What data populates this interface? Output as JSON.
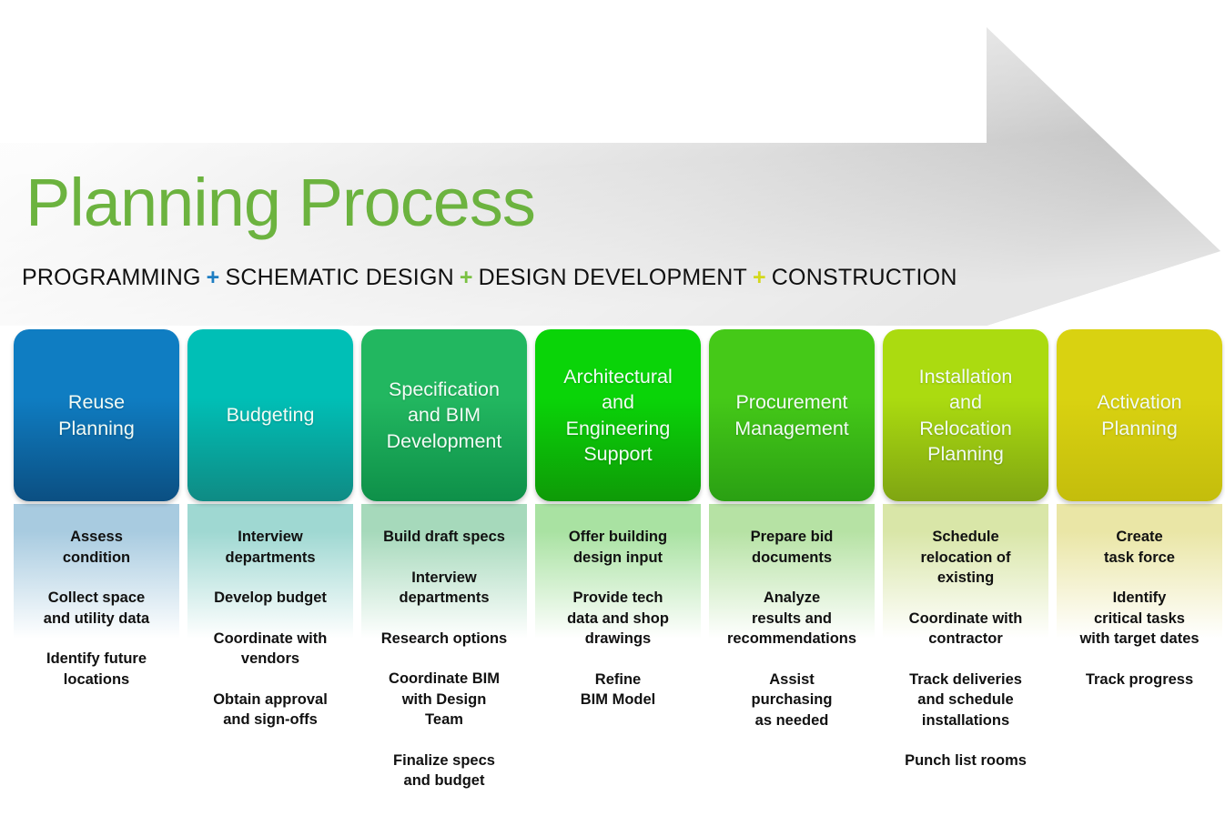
{
  "header": {
    "title": "Planning Process",
    "phases": [
      {
        "label": "PROGRAMMING",
        "separator_after": "+",
        "separator_color": "#1f7ec2"
      },
      {
        "label": "SCHEMATIC DESIGN",
        "separator_after": "+",
        "separator_color": "#7ac143"
      },
      {
        "label": "DESIGN DEVELOPMENT",
        "separator_after": "+",
        "separator_color": "#d3d81c"
      },
      {
        "label": "CONSTRUCTION",
        "separator_after": "",
        "separator_color": ""
      }
    ],
    "title_color": "#6cb33f"
  },
  "arrow": {
    "name": "process-arrow",
    "fill_light": "#fdfdfd",
    "fill_dark": "#bdbdbd"
  },
  "columns": [
    {
      "title": "Reuse\nPlanning",
      "title_lines": [
        "Reuse",
        "Planning"
      ],
      "color_top": "#0f7dc2",
      "color_bottom": "#0b4f82",
      "reflection_top": "#a8cbe0",
      "tasks": [
        "Assess\ncondition",
        "Collect space\nand utility data",
        "Identify future\nlocations"
      ]
    },
    {
      "title": "Budgeting",
      "title_lines": [
        "Budgeting"
      ],
      "color_top": "#00bfb6",
      "color_bottom": "#0f8b84",
      "reflection_top": "#9fd8d2",
      "tasks": [
        "Interview\ndepartments",
        "Develop budget",
        "Coordinate with\nvendors",
        "Obtain approval\nand sign-offs"
      ]
    },
    {
      "title": "Specification and BIM Development",
      "title_lines": [
        "Specification",
        "and BIM",
        "Development"
      ],
      "color_top": "#22b760",
      "color_bottom": "#0e9049",
      "reflection_top": "#a6d9bb",
      "tasks": [
        "Build draft specs",
        "Interview\ndepartments",
        "Research options",
        "Coordinate BIM\nwith Design\nTeam",
        "Finalize specs\nand budget"
      ]
    },
    {
      "title": "Architectural and Engineering Support",
      "title_lines": [
        "Architectural",
        "and",
        "Engineering",
        "Support"
      ],
      "color_top": "#0ad408",
      "color_bottom": "#0e9a07",
      "reflection_top": "#a9e2a2",
      "tasks": [
        "Offer building\ndesign input",
        "Provide tech\ndata and shop\ndrawings",
        "Refine\nBIM Model"
      ]
    },
    {
      "title": "Procurement Management",
      "title_lines": [
        "Procurement",
        "Management"
      ],
      "color_top": "#45c918",
      "color_bottom": "#2aa013",
      "reflection_top": "#b6e2a4",
      "tasks": [
        "Prepare bid\ndocuments",
        "Analyze\nresults and\nrecommendations",
        "Assist\npurchasing\nas needed"
      ]
    },
    {
      "title": "Installation and Relocation Planning",
      "title_lines": [
        "Installation",
        "and",
        "Relocation",
        "Planning"
      ],
      "color_top": "#abdb10",
      "color_bottom": "#7fa512",
      "reflection_top": "#d9e6a8",
      "tasks": [
        "Schedule\nrelocation of\nexisting",
        "Coordinate with\ncontractor",
        "Track deliveries\nand schedule\ninstallations",
        "Punch list rooms"
      ]
    },
    {
      "title": "Activation Planning",
      "title_lines": [
        "Activation",
        "Planning"
      ],
      "color_top": "#d9d211",
      "color_bottom": "#c4bd0c",
      "reflection_top": "#eae6a6",
      "tasks": [
        "Create\ntask force",
        "Identify\ncritical tasks\nwith target dates",
        "Track progress"
      ]
    }
  ]
}
